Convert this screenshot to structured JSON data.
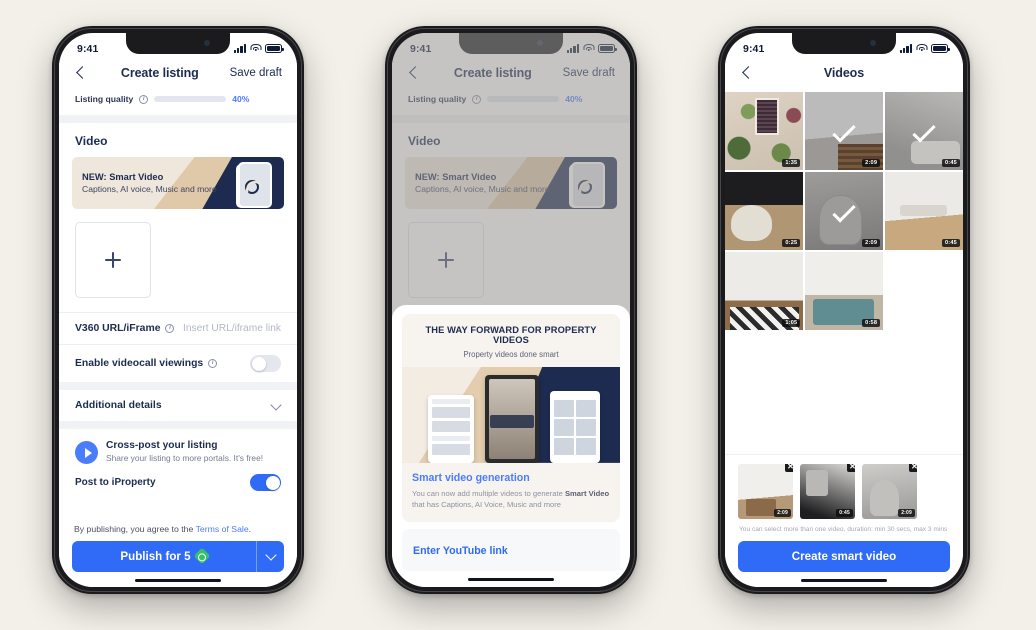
{
  "status_bar": {
    "time": "9:41"
  },
  "phone1": {
    "nav": {
      "back_icon": "chevron-left-icon",
      "title": "Create listing",
      "action": "Save draft"
    },
    "quality": {
      "label": "Listing quality",
      "info_icon": "info-icon",
      "percent_text": "40%",
      "percent_value": 40,
      "fill_color": "#4a7dfc"
    },
    "section_video_title": "Video",
    "promo": {
      "headline": "NEW: Smart Video",
      "subtext": "Captions, AI voice, Music and more",
      "icon": "camera-icon"
    },
    "add_video": {
      "icon": "plus-icon"
    },
    "v360": {
      "label": "V360 URL/iFrame",
      "info_icon": "info-icon",
      "placeholder": "Insert URL/iframe link"
    },
    "videocall": {
      "label": "Enable videocall viewings",
      "info_icon": "info-icon",
      "toggle_on": false
    },
    "additional_details": {
      "label": "Additional details",
      "icon": "chevron-down-icon"
    },
    "crosspost": {
      "title": "Cross-post your listing",
      "subtitle": "Share your listing to more portals. It's free!",
      "icon": "share-icon"
    },
    "portal": {
      "label": "Post to iProperty",
      "toggle_on": true
    },
    "terms": {
      "prefix": "By publishing, you agree to the ",
      "link": "Terms of Sale",
      "suffix": "."
    },
    "publish": {
      "label": "Publish for 5",
      "coin_icon": "coin-icon",
      "dropdown_icon": "chevron-down-icon",
      "color": "#2f6bf6"
    }
  },
  "phone2": {
    "nav": {
      "back_icon": "chevron-left-icon",
      "title": "Create listing",
      "action": "Save draft"
    },
    "quality": {
      "label": "Listing quality",
      "percent_text": "40%",
      "percent_value": 40
    },
    "section_video_title": "Video",
    "promo": {
      "headline": "NEW: Smart Video",
      "subtext": "Captions, AI voice, Music and more"
    },
    "add_video": {
      "icon": "plus-icon"
    },
    "sheet": {
      "card_title": "THE WAY FORWARD FOR PROPERTY VIDEOS",
      "card_subtitle": "Property videos done smart",
      "body_title": "Smart video generation",
      "body_text_1": "You can now add multiple videos to generate ",
      "body_highlight": "Smart Video",
      "body_text_2": " that has Captions, AI Voice, Music and more",
      "youtube_link": "Enter YouTube link"
    }
  },
  "phone3": {
    "nav": {
      "back_icon": "chevron-left-icon",
      "title": "Videos"
    },
    "grid": [
      {
        "name": "plants-terrace",
        "duration": "1:35",
        "selected": false,
        "style": "ph-plants"
      },
      {
        "name": "kitchen-counter",
        "duration": "2:09",
        "selected": true,
        "style": "ph-kitchen"
      },
      {
        "name": "bathroom-tub",
        "duration": "0:45",
        "selected": true,
        "style": "ph-bath"
      },
      {
        "name": "lounge-chair",
        "duration": "0:25",
        "selected": false,
        "style": "ph-chair"
      },
      {
        "name": "eames-chair",
        "duration": "2:09",
        "selected": true,
        "style": "ph-eames"
      },
      {
        "name": "dining-room",
        "duration": "0:45",
        "selected": false,
        "style": "ph-dining"
      },
      {
        "name": "bedroom-rug",
        "duration": "1:05",
        "selected": false,
        "style": "ph-bed1"
      },
      {
        "name": "bedroom-teal",
        "duration": "0:58",
        "selected": false,
        "style": "ph-bed2"
      }
    ],
    "tray": [
      {
        "name": "kitchen-thumb",
        "duration": "2:09",
        "remove_icon": "close-icon",
        "style": "ph-kit2"
      },
      {
        "name": "bathroom-thumb",
        "duration": "0:45",
        "remove_icon": "close-icon",
        "style": "ph-bath2"
      },
      {
        "name": "chair-thumb",
        "duration": "2:09",
        "remove_icon": "close-icon",
        "style": "ph-chair2"
      }
    ],
    "hint": "You can select more than one video, duration: min 30 secs, max 3 mins",
    "cta": {
      "label": "Create smart video",
      "color": "#2f6bf6"
    }
  }
}
